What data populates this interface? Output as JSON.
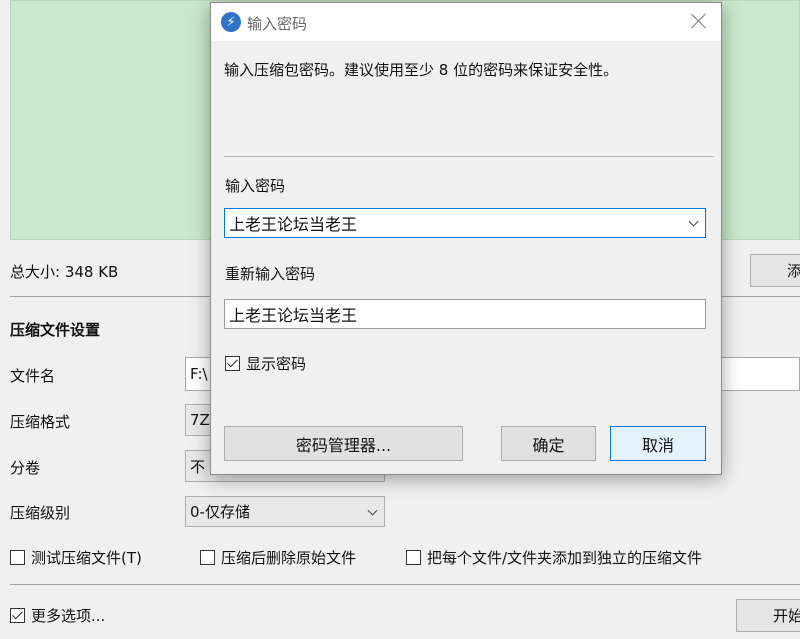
{
  "main": {
    "total_size": "总大小: 348 KB",
    "add_button": "添",
    "settings_title": "压缩文件设置",
    "filename_label": "文件名",
    "filename_value": "F:\\",
    "format_label": "压缩格式",
    "format_value": "7Z",
    "split_label": "分卷",
    "split_value": "不",
    "level_label": "压缩级别",
    "level_value": "0-仅存储",
    "test_archive": "测试压缩文件(T)",
    "delete_after": "压缩后删除原始文件",
    "separate_archives": "把每个文件/文件夹添加到独立的压缩文件",
    "more_options": "更多选项...",
    "start_button": "开始"
  },
  "dialog": {
    "title": "输入密码",
    "description": "输入压缩包密码。建议使用至少 8 位的密码来保证安全性。",
    "password_label": "输入密码",
    "password_value": "上老王论坛当老王",
    "confirm_label": "重新输入密码",
    "confirm_value": "上老王论坛当老王",
    "show_password": "显示密码",
    "manager_button": "密码管理器...",
    "ok_button": "确定",
    "cancel_button": "取消"
  }
}
